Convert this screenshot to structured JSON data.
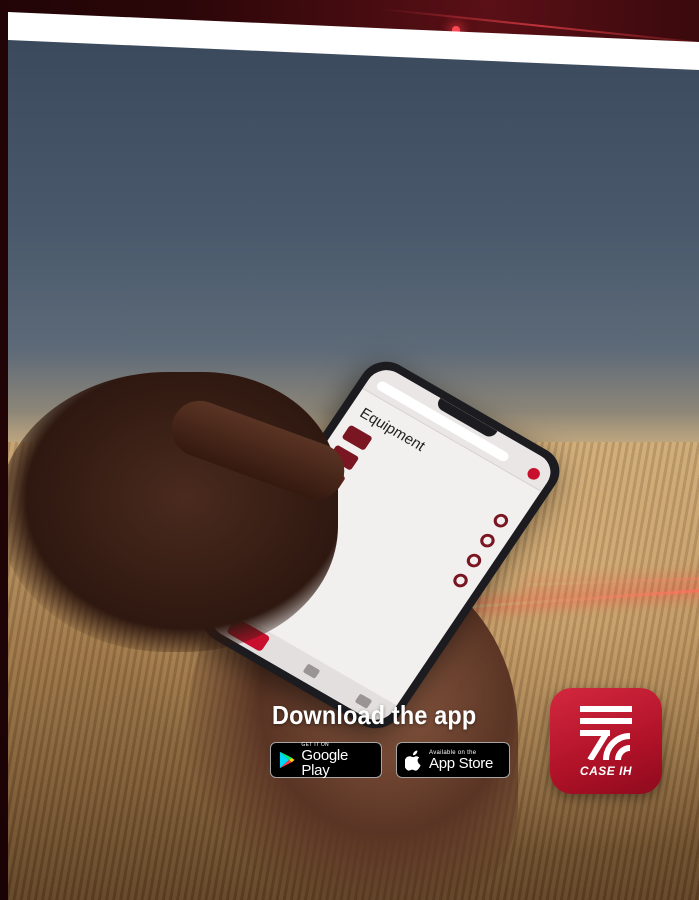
{
  "phone_screen": {
    "title": "Equipment"
  },
  "download": {
    "title": "Download the app",
    "google_play": {
      "small": "GET IT ON",
      "big": "Google Play",
      "icon": "google-play-icon"
    },
    "app_store": {
      "small": "Available on the",
      "big": "App Store",
      "icon": "apple-icon"
    }
  },
  "app_icon": {
    "brand": "CASE IH",
    "icon": "case-ih-app-icon"
  },
  "colors": {
    "brand_red": "#c8102e",
    "frame": "#2a0608",
    "badge_bg": "#000000"
  }
}
